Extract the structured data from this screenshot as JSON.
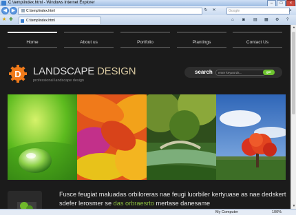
{
  "browser": {
    "title": "C:\\temp\\index.html - Windows Internet Explorer",
    "url": "C:\\temp\\index.html",
    "search_placeholder": "Google",
    "tab_title": "C:\\temp\\index.html",
    "status_zone": "My Computer",
    "status_zoom": "100%"
  },
  "site": {
    "menu": [
      "Home",
      "About us",
      "Portfolio",
      "Plantings",
      "Contact Us"
    ],
    "brand_part1": "LANDSCAPE",
    "brand_part2": "DESIGN",
    "tagline": "professional landscape design",
    "search_label": "search",
    "search_placeholder": "enter keywords...",
    "search_button": "go!",
    "news_text_1": "Fusce feugiat maluadas orbiloreras nae feugi luorbiler kertyuase as nae dedskert sdefer lerosmer se ",
    "news_link": "das orbraesrto",
    "news_text_2": " mertase danesame",
    "colors": {
      "page_bg": "#1b1b1b",
      "accent_green": "#6dc32e",
      "link_green": "#8cbf3f",
      "logo_orange": "#f07a1a"
    }
  }
}
